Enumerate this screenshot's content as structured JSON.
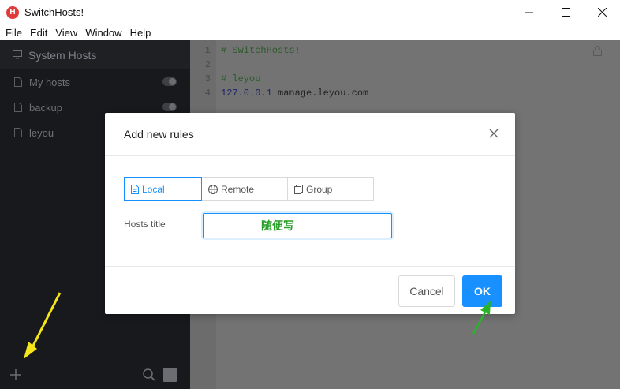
{
  "window": {
    "title": "SwitchHosts!",
    "app_icon_letter": "H"
  },
  "menu": [
    "File",
    "Edit",
    "View",
    "Window",
    "Help"
  ],
  "sidebar": {
    "header": "System Hosts",
    "items": [
      {
        "label": "My hosts",
        "toggle": true
      },
      {
        "label": "backup",
        "toggle": true
      },
      {
        "label": "leyou",
        "toggle": false
      }
    ]
  },
  "editor": {
    "lines": [
      {
        "num": "1",
        "text": "# SwitchHosts!"
      },
      {
        "num": "2",
        "text": ""
      },
      {
        "num": "3",
        "text": "# leyou"
      },
      {
        "num": "4",
        "ip": "127.0.0.1",
        "host": "manage.leyou.com"
      }
    ]
  },
  "dialog": {
    "title": "Add new rules",
    "tabs": [
      "Local",
      "Remote",
      "Group"
    ],
    "active_tab": "Local",
    "hosts_title_label": "Hosts title",
    "hosts_title_value": "随便写",
    "cancel": "Cancel",
    "ok": "OK"
  },
  "colors": {
    "accent": "#1890ff",
    "sidebar_bg": "#17191c",
    "editor_bg": "#737373",
    "annotation_yellow": "#f5e619",
    "annotation_green": "#2ab32a"
  }
}
